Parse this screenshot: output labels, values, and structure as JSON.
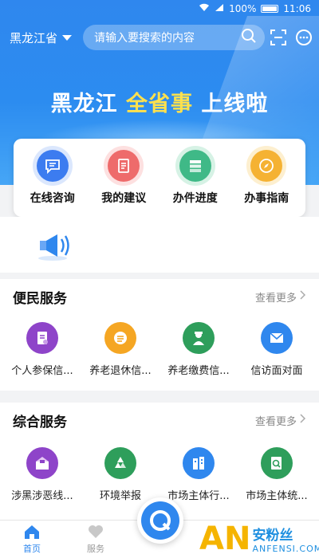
{
  "status_bar": {
    "battery": "100%",
    "time": "11:06"
  },
  "header": {
    "region": "黑龙江省",
    "search_placeholder": "请输入要搜索的内容",
    "icons": [
      "scan-icon",
      "message-icon"
    ]
  },
  "banner": {
    "part1": "黑龙江 ",
    "highlight": "全省事",
    "part2": " 上线啦"
  },
  "quick_actions": [
    {
      "label": "在线咨询",
      "icon": "chat-icon",
      "color": "#3c7cf0"
    },
    {
      "label": "我的建议",
      "icon": "document-icon",
      "color": "#ee6b6b"
    },
    {
      "label": "办件进度",
      "icon": "progress-icon",
      "color": "#3fb987"
    },
    {
      "label": "办事指南",
      "icon": "compass-icon",
      "color": "#f5b233"
    }
  ],
  "convenience_services": {
    "title": "便民服务",
    "more": "查看更多",
    "items": [
      {
        "label": "个人参保信...",
        "icon": "insurance-doc-icon",
        "color": "#8e44c9"
      },
      {
        "label": "养老退休信...",
        "icon": "retirement-icon",
        "color": "#f5a623"
      },
      {
        "label": "养老缴费信...",
        "icon": "elderly-icon",
        "color": "#2e9e5b"
      },
      {
        "label": "信访面对面",
        "icon": "mail-icon",
        "color": "#2f87ee"
      }
    ]
  },
  "comprehensive_services": {
    "title": "综合服务",
    "more": "查看更多",
    "items": [
      {
        "label": "涉黑涉恶线...",
        "icon": "report-box-icon",
        "color": "#8e44c9"
      },
      {
        "label": "环境举报",
        "icon": "recycle-icon",
        "color": "#2e9e5b"
      },
      {
        "label": "市场主体行...",
        "icon": "building-icon",
        "color": "#2f87ee"
      },
      {
        "label": "市场主体统...",
        "icon": "search-doc-icon",
        "color": "#2e9e5b"
      }
    ]
  },
  "tabbar": {
    "tabs": [
      {
        "label": "首页",
        "icon": "home-icon",
        "active": true
      },
      {
        "label": "服务",
        "icon": "heart-icon",
        "active": false
      }
    ]
  },
  "watermark": {
    "logo": "AN",
    "cn": "安粉丝",
    "en": "ANFENSI.COM"
  }
}
